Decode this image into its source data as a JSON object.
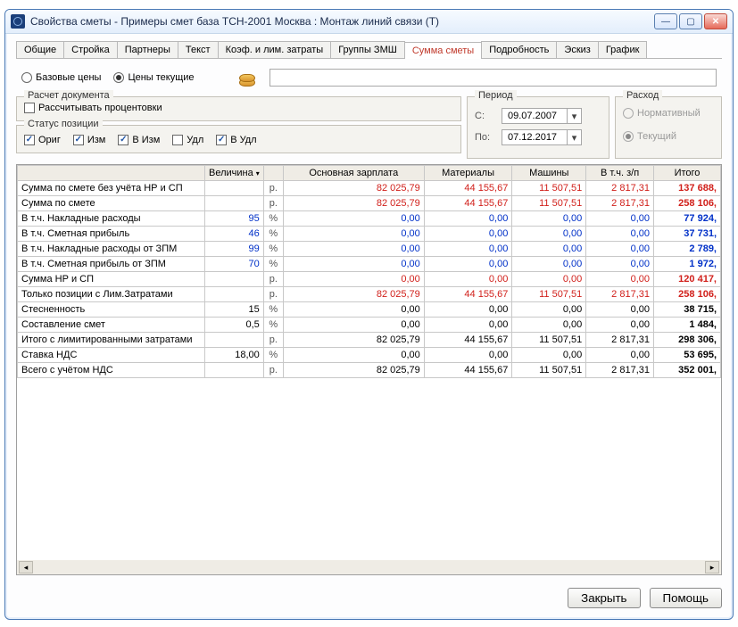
{
  "title": "Свойства сметы - Примеры смет база ТСН-2001 Москва : Монтаж линий связи (Т)",
  "tabs": [
    "Общие",
    "Стройка",
    "Партнеры",
    "Текст",
    "Коэф. и лим. затраты",
    "Группы ЗМШ",
    "Сумма сметы",
    "Подробность",
    "Эскиз",
    "График"
  ],
  "active_tab": 6,
  "prices": {
    "base": "Базовые цены",
    "current": "Цены текущие"
  },
  "doc": {
    "legend": "Расчет документа",
    "calc_pct": "Рассчитывать процентовки"
  },
  "status": {
    "legend": "Статус позиции",
    "items": [
      {
        "label": "Ориг",
        "checked": true
      },
      {
        "label": "Изм",
        "checked": true
      },
      {
        "label": "В Изм",
        "checked": true
      },
      {
        "label": "Удл",
        "checked": false
      },
      {
        "label": "В Удл",
        "checked": true
      }
    ]
  },
  "period": {
    "legend": "Период",
    "from_lbl": "С:",
    "to_lbl": "По:",
    "from": "09.07.2007",
    "to": "07.12.2017"
  },
  "rashod": {
    "legend": "Расход",
    "norm": "Нормативный",
    "cur": "Текущий"
  },
  "headers": [
    "",
    "Величина",
    "",
    "Основная зарплата",
    "Материалы",
    "Машины",
    "В т.ч. з/п",
    "Итого"
  ],
  "rows": [
    {
      "name": "Сумма по смете без учёта НР и СП",
      "val": "",
      "unit": "р.",
      "c0": "82 025,79",
      "c1": "44 155,67",
      "c2": "11 507,51",
      "c3": "2 817,31",
      "it": "137 688,",
      "cls": "red",
      "itcls": "c-red"
    },
    {
      "name": "Сумма по смете",
      "val": "",
      "unit": "р.",
      "c0": "82 025,79",
      "c1": "44 155,67",
      "c2": "11 507,51",
      "c3": "2 817,31",
      "it": "258 106,",
      "cls": "red",
      "itcls": "c-red"
    },
    {
      "name": "  В т.ч. Накладные расходы",
      "val": "95",
      "unit": "%",
      "c0": "0,00",
      "c1": "0,00",
      "c2": "0,00",
      "c3": "0,00",
      "it": "77 924,",
      "cls": "blue",
      "itcls": "c-blue"
    },
    {
      "name": "  В т.ч. Сметная прибыль",
      "val": "46",
      "unit": "%",
      "c0": "0,00",
      "c1": "0,00",
      "c2": "0,00",
      "c3": "0,00",
      "it": "37 731,",
      "cls": "blue",
      "itcls": "c-blue"
    },
    {
      "name": "  В т.ч. Накладные расходы от ЗПМ",
      "val": "99",
      "unit": "%",
      "c0": "0,00",
      "c1": "0,00",
      "c2": "0,00",
      "c3": "0,00",
      "it": "2 789,",
      "cls": "blue",
      "itcls": "c-blue"
    },
    {
      "name": "  В т.ч. Сметная прибыль от ЗПМ",
      "val": "70",
      "unit": "%",
      "c0": "0,00",
      "c1": "0,00",
      "c2": "0,00",
      "c3": "0,00",
      "it": "1 972,",
      "cls": "blue",
      "itcls": "c-blue"
    },
    {
      "name": "Сумма НР и СП",
      "val": "",
      "unit": "р.",
      "c0": "0,00",
      "c1": "0,00",
      "c2": "0,00",
      "c3": "0,00",
      "it": "120 417,",
      "cls": "red",
      "itcls": "c-red"
    },
    {
      "name": "Только позиции с Лим.Затратами",
      "val": "",
      "unit": "р.",
      "c0": "82 025,79",
      "c1": "44 155,67",
      "c2": "11 507,51",
      "c3": "2 817,31",
      "it": "258 106,",
      "cls": "red",
      "itcls": "c-red"
    },
    {
      "name": "Стесненность",
      "val": "15",
      "unit": "%",
      "c0": "0,00",
      "c1": "0,00",
      "c2": "0,00",
      "c3": "0,00",
      "it": "38 715,",
      "cls": "black",
      "itcls": "c-black"
    },
    {
      "name": "Составление смет",
      "val": "0,5",
      "unit": "%",
      "c0": "0,00",
      "c1": "0,00",
      "c2": "0,00",
      "c3": "0,00",
      "it": "1 484,",
      "cls": "black",
      "itcls": "c-black"
    },
    {
      "name": "Итого с лимитированными затратами",
      "val": "",
      "unit": "р.",
      "c0": "82 025,79",
      "c1": "44 155,67",
      "c2": "11 507,51",
      "c3": "2 817,31",
      "it": "298 306,",
      "cls": "black",
      "itcls": "c-black"
    },
    {
      "name": "Ставка НДС",
      "val": "18,00",
      "unit": "%",
      "c0": "0,00",
      "c1": "0,00",
      "c2": "0,00",
      "c3": "0,00",
      "it": "53 695,",
      "cls": "black",
      "itcls": "c-black"
    },
    {
      "name": "Всего с учётом НДС",
      "val": "",
      "unit": "р.",
      "c0": "82 025,79",
      "c1": "44 155,67",
      "c2": "11 507,51",
      "c3": "2 817,31",
      "it": "352 001,",
      "cls": "black",
      "itcls": "c-black"
    }
  ],
  "footer": {
    "close": "Закрыть",
    "help": "Помощь"
  }
}
